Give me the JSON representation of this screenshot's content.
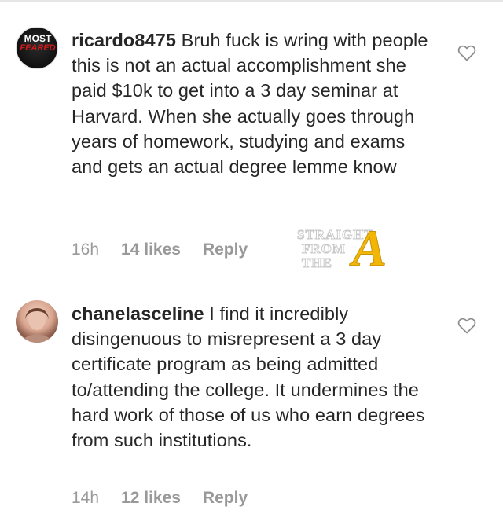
{
  "comments": [
    {
      "username": "ricardo8475",
      "text": " Bruh fuck is wring with people this is not an actual accomplishment she paid $10k to get into a 3 day seminar at Harvard. When she actually goes through years of homework, studying and exams and gets an actual degree lemme know",
      "time": "16h",
      "likes": "14 likes",
      "reply": "Reply",
      "avatar_text_top": "MOST",
      "avatar_text_bottom": "FEARED"
    },
    {
      "username": "chanelasceline",
      "text": " I find it incredibly disingenuous to misrepresent a 3 day certificate program as being admitted to/attending the college. It undermines the hard work of those of us who earn degrees from such institutions.",
      "time": "14h",
      "likes": "12 likes",
      "reply": "Reply"
    }
  ],
  "watermark": {
    "line1": "STRAIGHT",
    "line2": "FROM",
    "line3": "THE",
    "letter": "A"
  },
  "colors": {
    "text": "#262626",
    "meta": "#999999",
    "watermark_gold": "#f2b705"
  }
}
